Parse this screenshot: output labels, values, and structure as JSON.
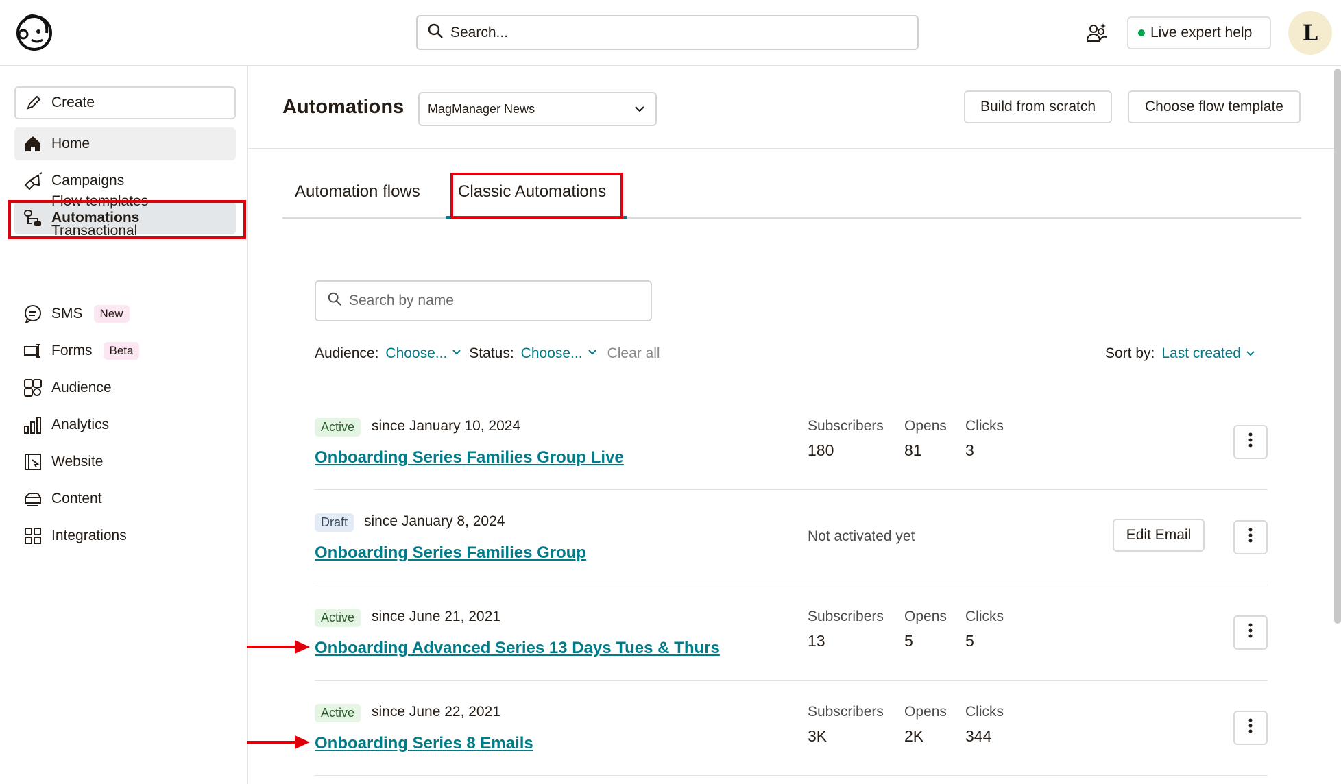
{
  "header": {
    "search_placeholder": "Search...",
    "live_help_label": "Live expert help",
    "avatar_initial": "L"
  },
  "sidebar": {
    "create_label": "Create",
    "items": [
      {
        "label": "Home",
        "icon": "home-icon"
      },
      {
        "label": "Campaigns",
        "icon": "megaphone-icon"
      },
      {
        "label": "Automations",
        "icon": "automations-icon"
      },
      {
        "label": "SMS",
        "icon": "chat-icon",
        "pill": "New"
      },
      {
        "label": "Forms",
        "icon": "forms-icon",
        "pill": "Beta"
      },
      {
        "label": "Audience",
        "icon": "audience-icon"
      },
      {
        "label": "Analytics",
        "icon": "bar-chart-icon"
      },
      {
        "label": "Website",
        "icon": "website-icon"
      },
      {
        "label": "Content",
        "icon": "content-icon"
      },
      {
        "label": "Integrations",
        "icon": "grid-icon"
      }
    ],
    "sub_items": [
      "Flow templates",
      "Transactional"
    ]
  },
  "main": {
    "title": "Automations",
    "audience_select": "MagManager News",
    "build_label": "Build from scratch",
    "template_label": "Choose flow template",
    "tabs": [
      {
        "label": "Automation flows",
        "active": false
      },
      {
        "label": "Classic Automations",
        "active": true
      }
    ],
    "name_search_placeholder": "Search by name",
    "filters": {
      "audience_label": "Audience:",
      "audience_value": "Choose...",
      "status_label": "Status:",
      "status_value": "Choose...",
      "clear_label": "Clear all",
      "sort_label": "Sort by:",
      "sort_value": "Last created"
    },
    "stat_headers": {
      "subscribers": "Subscribers",
      "opens": "Opens",
      "clicks": "Clicks"
    },
    "rows": [
      {
        "status": "Active",
        "since": "since January 10, 2024",
        "name": "Onboarding Series Families Group Live",
        "subscribers": "180",
        "opens": "81",
        "clicks": "3"
      },
      {
        "status": "Draft",
        "since": "since January 8, 2024",
        "name": "Onboarding Series Families Group",
        "not_activated": "Not activated yet",
        "edit_label": "Edit Email"
      },
      {
        "status": "Active",
        "since": "since June 21, 2021",
        "name": "Onboarding Advanced Series 13 Days Tues & Thurs",
        "subscribers": "13",
        "opens": "5",
        "clicks": "5"
      },
      {
        "status": "Active",
        "since": "since June 22, 2021",
        "name": "Onboarding Series 8 Emails",
        "subscribers": "3K",
        "opens": "2K",
        "clicks": "344"
      }
    ]
  },
  "colors": {
    "accent": "#007c89",
    "highlight": "#e0000a",
    "active_badge": "#e4f5e4",
    "draft_badge": "#e3ecf6"
  }
}
